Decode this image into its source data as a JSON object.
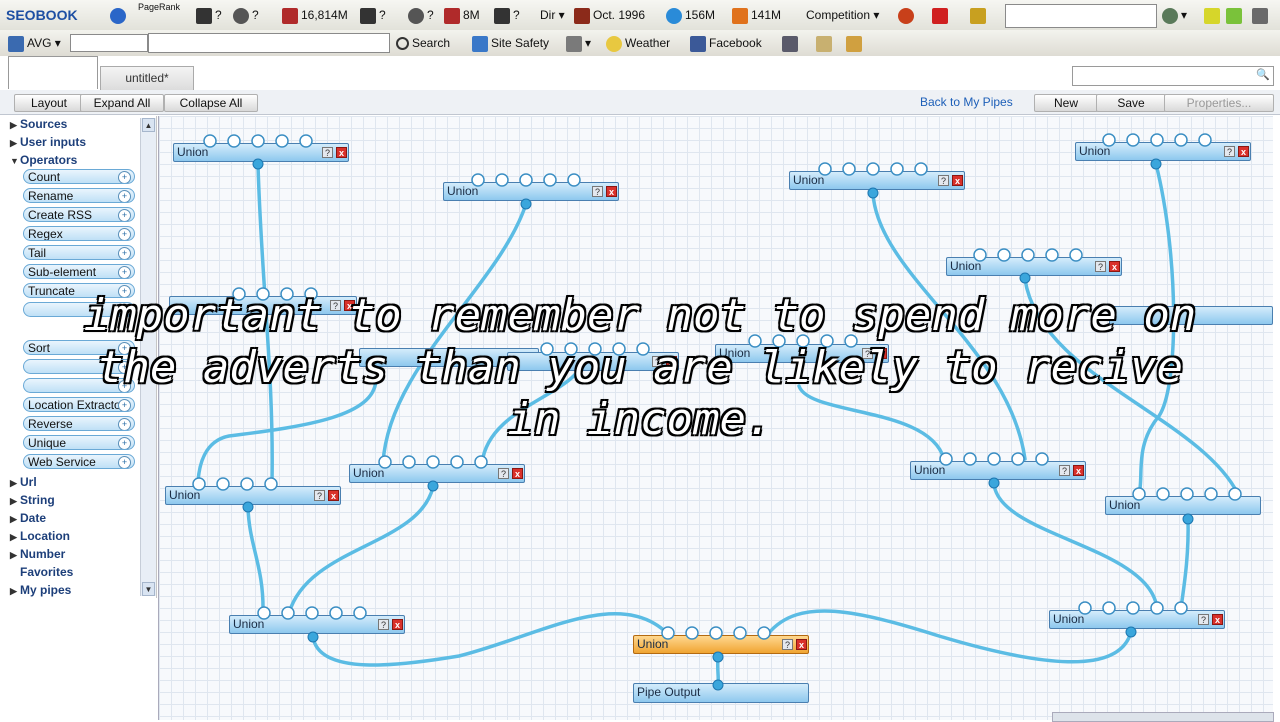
{
  "toolbar1": {
    "seobook": "SEOBOOK",
    "pagerank_label": "PageRank",
    "q1": "?",
    "q2": "?",
    "q3": "?",
    "count1": "16,814M",
    "q4": "?",
    "q5": "?",
    "count2": "8M",
    "q6": "?",
    "dir_label": "Dir",
    "date": "Oct. 1996",
    "count3": "156M",
    "count4": "141M",
    "competition_label": "Competition"
  },
  "toolbar2": {
    "avg_label": "AVG",
    "search_label": "Search",
    "site_safety_label": "Site Safety",
    "weather_label": "Weather",
    "facebook_label": "Facebook"
  },
  "tabs": {
    "untitled": "untitled*"
  },
  "actions": {
    "layout": "Layout",
    "expand_all": "Expand All",
    "collapse_all": "Collapse All",
    "back_to_pipes": "Back to My Pipes",
    "new": "New",
    "save": "Save",
    "properties": "Properties..."
  },
  "sidebar": {
    "categories_top": [
      "Sources",
      "User inputs",
      "Operators"
    ],
    "operators": [
      "Count",
      "Rename",
      "Create RSS",
      "Regex",
      "Tail",
      "Sub-element",
      "Truncate",
      "",
      "Sort",
      "",
      "",
      "Location Extractor",
      "Reverse",
      "Unique",
      "Web Service"
    ],
    "categories_bottom": [
      "Url",
      "String",
      "Date",
      "Location",
      "Number",
      "Favorites",
      "My pipes"
    ]
  },
  "modules": {
    "union_label": "Union",
    "output_label": "Pipe Output",
    "help_glyph": "?",
    "close_glyph": "x"
  },
  "overlay": {
    "line1": "important to remember not to spend more on",
    "line2": "the adverts than you are likely to recive",
    "line3": "in income."
  },
  "colors": {
    "wire": "#5bbce4",
    "module_blue": "#a6d6f3",
    "module_orange": "#f5b54a",
    "close_red": "#d9312b"
  }
}
